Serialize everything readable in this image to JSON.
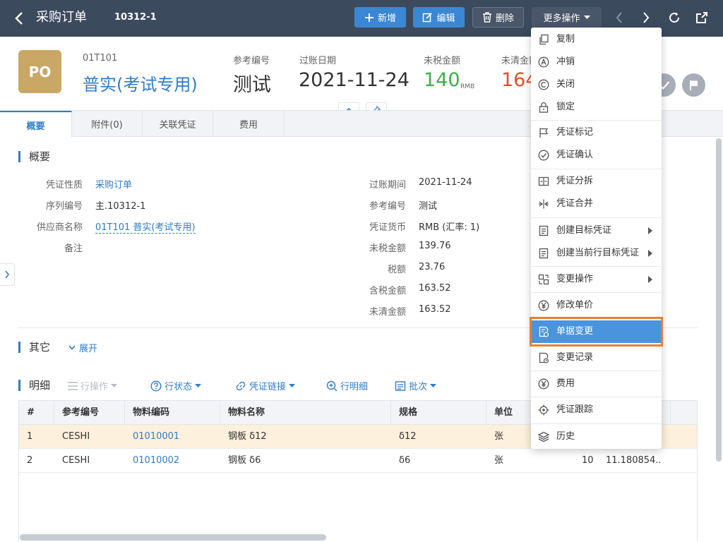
{
  "header": {
    "title": "采购订单",
    "doc_number": "10312-1",
    "buttons": {
      "add": "新增",
      "edit": "编辑",
      "delete": "删除",
      "more": "更多操作"
    }
  },
  "summary": {
    "avatar_text": "PO",
    "supplier_code": "01T101",
    "supplier_name": "普实(考试专用)",
    "ref_label": "参考编号",
    "ref_value": "测试",
    "date_label": "过账日期",
    "date_value": "2021-11-24",
    "untaxed_label": "未税金额",
    "untaxed_value": "140",
    "untaxed_unit": "RMB",
    "uncleared_label": "未清金额",
    "uncleared_value": "164"
  },
  "tabs": [
    {
      "label": "概要"
    },
    {
      "label": "附件(0)"
    },
    {
      "label": "关联凭证"
    },
    {
      "label": "费用"
    }
  ],
  "overview": {
    "title": "概要",
    "left_fields": [
      {
        "label": "凭证性质",
        "value": "采购订单"
      },
      {
        "label": "序列编号",
        "value": "主.10312-1"
      },
      {
        "label": "供应商名称",
        "value": "01T101 普实(考试专用)"
      },
      {
        "label": "备注",
        "value": ""
      }
    ],
    "right_fields": [
      {
        "label": "过账期间",
        "value": "2021-11-24"
      },
      {
        "label": "参考编号",
        "value": "测试"
      },
      {
        "label": "凭证货币",
        "value": "RMB (汇率: 1)"
      },
      {
        "label": "未税金额",
        "value": "139.76"
      },
      {
        "label": "税额",
        "value": "23.76"
      },
      {
        "label": "含税金额",
        "value": "163.52"
      },
      {
        "label": "未清金额",
        "value": "163.52"
      }
    ]
  },
  "other": {
    "title": "其它",
    "expand": "展开"
  },
  "detail": {
    "title": "明细",
    "toolbar": {
      "row_ops": "行操作",
      "row_status": "行状态",
      "link": "凭证链接",
      "row_detail": "行明细",
      "batch": "批次"
    },
    "columns": [
      "#",
      "参考编号",
      "物料编码",
      "物料名称",
      "规格",
      "单位"
    ],
    "rows": [
      {
        "no": "1",
        "ref": "CESHI",
        "code": "01010001",
        "name": "钢板 δ12",
        "spec": "δ12",
        "unit": "张",
        "qty": "",
        "price": ""
      },
      {
        "no": "2",
        "ref": "CESHI",
        "code": "01010002",
        "name": "钢板 δ6",
        "spec": "δ6",
        "unit": "张",
        "qty": "10",
        "price": "11.180854..."
      }
    ]
  },
  "menu": {
    "items": [
      {
        "label": "复制",
        "icon": "copy-icon"
      },
      {
        "label": "冲销",
        "icon": "reverse-icon"
      },
      {
        "label": "关闭",
        "icon": "close-doc-icon"
      },
      {
        "label": "锁定",
        "icon": "lock-icon"
      },
      {
        "label": "凭证标记",
        "icon": "flag-icon"
      },
      {
        "label": "凭证确认",
        "icon": "check-circle-icon"
      },
      {
        "label": "凭证分拆",
        "icon": "split-icon"
      },
      {
        "label": "凭证合并",
        "icon": "merge-icon"
      },
      {
        "label": "创建目标凭证",
        "icon": "document-icon"
      },
      {
        "label": "创建当前行目标凭证",
        "icon": "document-icon"
      },
      {
        "label": "变更操作",
        "icon": "change-icon"
      },
      {
        "label": "修改单价",
        "icon": "yen-icon"
      },
      {
        "label": "单据变更",
        "icon": "doc-change-icon"
      },
      {
        "label": "变更记录",
        "icon": "doc-record-icon"
      },
      {
        "label": "费用",
        "icon": "fee-icon"
      },
      {
        "label": "凭证跟踪",
        "icon": "target-icon"
      },
      {
        "label": "历史",
        "icon": "layers-icon"
      }
    ]
  },
  "colors": {
    "topbar": "#3c4a5e",
    "accent": "#2f7cc9",
    "primary_button": "#3a87d6",
    "green": "#3cb24a",
    "red": "#e0512a",
    "highlight": "#e8802b",
    "selected_row": "#fdf0dc"
  }
}
